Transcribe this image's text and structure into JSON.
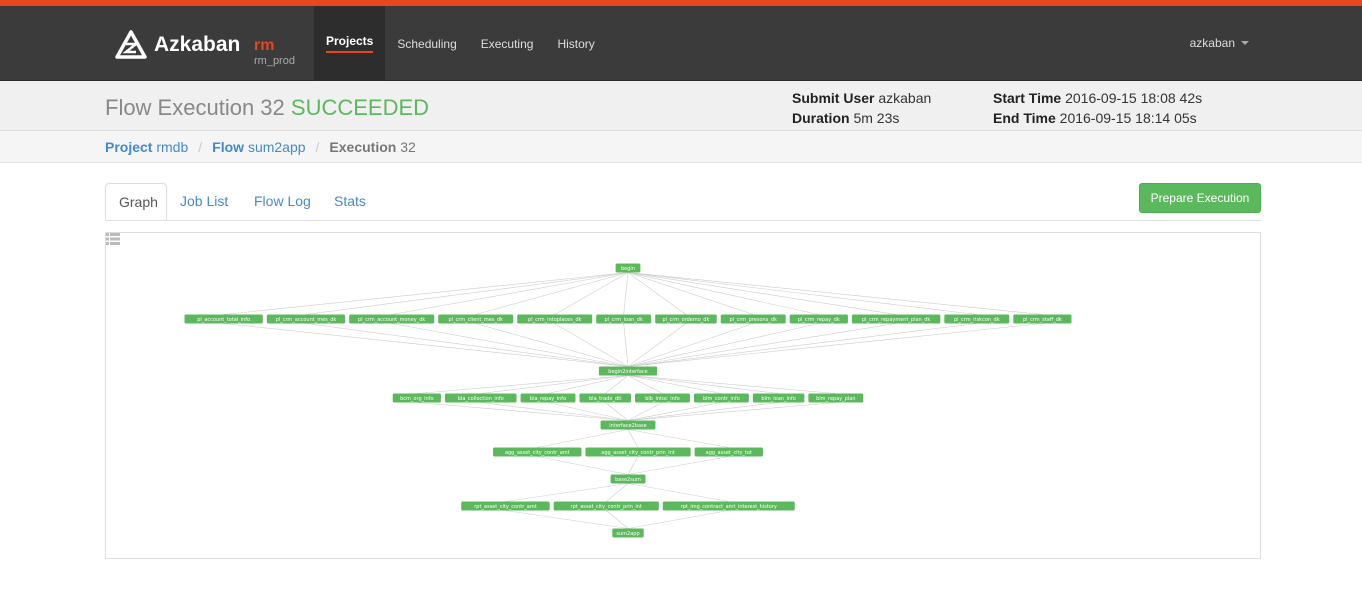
{
  "brand": {
    "name": "Azkaban",
    "env": "rm",
    "env_sub": "rm_prod"
  },
  "nav": {
    "items": [
      "Projects",
      "Scheduling",
      "Executing",
      "History"
    ],
    "active": "Projects"
  },
  "user": {
    "name": "azkaban"
  },
  "header": {
    "title_prefix": "Flow Execution 32",
    "status": "SUCCEEDED",
    "submit_user_label": "Submit User",
    "submit_user": "azkaban",
    "duration_label": "Duration",
    "duration": "5m 23s",
    "start_time_label": "Start Time",
    "start_time": "2016-09-15 18:08 42s",
    "end_time_label": "End Time",
    "end_time": "2016-09-15 18:14 05s"
  },
  "breadcrumb": {
    "project_label": "Project",
    "project": "rmdb",
    "flow_label": "Flow",
    "flow": "sum2app",
    "execution_label": "Execution",
    "execution": "32"
  },
  "tabs": [
    "Graph",
    "Job List",
    "Flow Log",
    "Stats"
  ],
  "active_tab": "Graph",
  "prepare_button": "Prepare Execution",
  "status_color": "#5cb85c",
  "graph": {
    "levels": [
      [
        "begin"
      ],
      [
        "pl_account_total_info",
        "pl_crm_account_mes_dk",
        "pl_crm_account_money_dk",
        "pl_crm_client_mes_dk",
        "pl_crm_intoplaces_dk",
        "pl_crm_loan_dk",
        "pl_crm_ordemo_dk",
        "pl_crm_presons_dk",
        "pl_crm_repay_dk",
        "pl_crm_repayment_plan_dk",
        "pl_crm_riskcon_dk",
        "pl_crm_staff_dk"
      ],
      [
        "begin2interface"
      ],
      [
        "bcm_org_info",
        "bla_collection_info",
        "bla_repay_info",
        "bla_trade_dtl",
        "blb_intoc_info",
        "blm_contr_info",
        "blm_loan_info",
        "blm_repay_plan"
      ],
      [
        "interface2base"
      ],
      [
        "agg_asset_city_contr_amt",
        "agg_asset_city_contr_prin_int",
        "agg_asset_city_tot"
      ],
      [
        "base2sum"
      ],
      [
        "rpt_asset_city_contr_amt",
        "rpt_asset_city_contr_prin_int",
        "rpt_img_contract_amt_interest_history"
      ],
      [
        "sum2app"
      ]
    ]
  }
}
